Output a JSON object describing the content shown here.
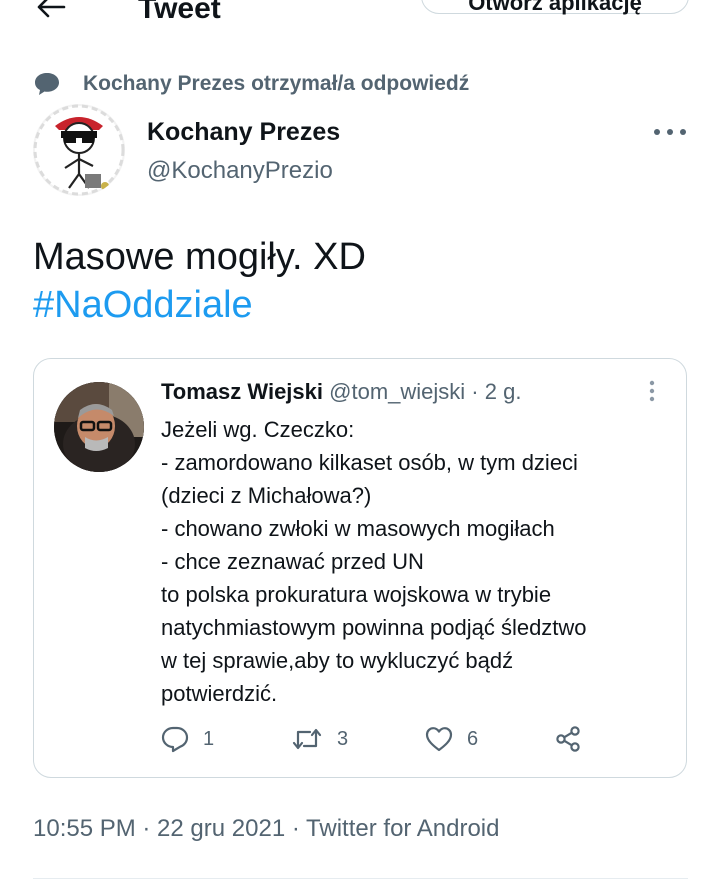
{
  "header": {
    "title": "Tweet",
    "open_app_label": "Otwórz aplikację"
  },
  "reply_context": {
    "text": "Kochany Prezes otrzymał/a odpowiedź"
  },
  "tweet": {
    "author_name": "Kochany Prezes",
    "author_handle": "@KochanyPrezio",
    "text": "Masowe mogiły. XD",
    "hashtag": "#NaOddziale",
    "timestamp": "10:55 PM · 22 gru 2021 · Twitter for Android"
  },
  "quote": {
    "author_name": "Tomasz Wiejski",
    "author_handle": "@tom_wiejski",
    "time": "· 2 g.",
    "lines": [
      "Jeżeli wg. Czeczko:",
      "- zamordowano kilkaset osób, w tym dzieci",
      "(dzieci z Michałowa?)",
      "- chowano zwłoki w masowych mogiłach",
      "- chce zeznawać przed UN",
      "to polska prokuratura wojskowa w trybie",
      "natychmiastowym powinna podjąć śledztwo",
      "w tej sprawie,aby to wykluczyć bądź",
      "potwierdzić."
    ],
    "replies": "1",
    "retweets": "3",
    "likes": "6"
  },
  "colors": {
    "accent": "#1d9bf0",
    "secondary_text": "#536471",
    "border": "#cfd9de"
  },
  "icons": {
    "back": "arrow-left-icon",
    "reply_context": "speech-bubble-icon",
    "more": "more-horizontal-icon",
    "quote_more": "more-vertical-icon",
    "reply": "reply-icon",
    "retweet": "retweet-icon",
    "like": "heart-icon",
    "share": "share-icon"
  }
}
